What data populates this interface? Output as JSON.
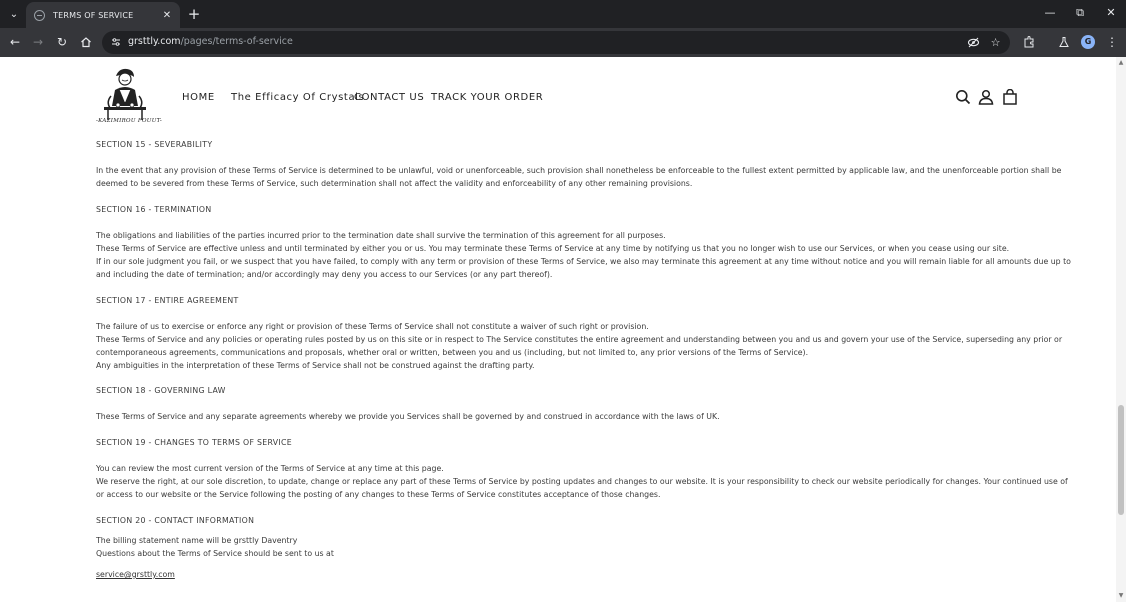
{
  "browser": {
    "tab_title": "TERMS OF SERVICE",
    "url_host": "grsttly.com",
    "url_path": "/pages/terms-of-service",
    "profile_initial": "G"
  },
  "site": {
    "logo_text": "-KAZIMIROU FOUUT-",
    "nav": [
      "HOME",
      "The Efficacy Of Crystals",
      "CONTACT US",
      "TRACK YOUR ORDER"
    ]
  },
  "content": {
    "s15_title": "SECTION 15 - SEVERABILITY",
    "s15_p1": "In the event that any provision of these Terms of Service is determined to be unlawful, void or unenforceable, such provision shall nonetheless be enforceable to the fullest extent permitted by applicable law, and the unenforceable portion shall be",
    "s15_p2": "deemed to be severed from these Terms of Service, such determination shall not affect the validity and enforceability of any other remaining provisions.",
    "s16_title": "SECTION 16 - TERMINATION",
    "s16_p1": "The obligations and liabilities of the parties incurred prior to the termination date shall survive the termination of this agreement for all purposes.",
    "s16_p2": "These Terms of Service are effective unless and until terminated by either you or us. You may terminate these Terms of Service at any time by notifying us that you no longer wish to use our Services, or when you cease using our site.",
    "s16_p3": "If in our sole judgment you fail, or we suspect that you have failed, to comply with any term or provision of these Terms of Service, we also may terminate this agreement at any time without notice and you will remain liable for all amounts due up to",
    "s16_p4": "and including the date of termination; and/or accordingly may deny you access to our Services (or any part thereof).",
    "s17_title": "SECTION 17 - ENTIRE AGREEMENT",
    "s17_p1": "The failure of us to exercise or enforce any right or provision of these Terms of Service shall not constitute a waiver of such right or provision.",
    "s17_p2": "These Terms of Service and any policies or operating rules posted by us on this site or in respect to The Service constitutes the entire agreement and understanding between you and us and govern your use of the Service, superseding any prior or",
    "s17_p3": "contemporaneous agreements, communications and proposals, whether oral or written, between you and us (including, but not limited to, any prior versions of the Terms of Service).",
    "s17_p4": "Any ambiguities in the interpretation of these Terms of Service shall not be construed against the drafting party.",
    "s18_title": "SECTION 18 - GOVERNING LAW",
    "s18_p1": "These Terms of Service and any separate agreements whereby we provide you Services shall be governed by and construed in accordance with the laws of UK.",
    "s19_title": "SECTION 19 - CHANGES TO TERMS OF SERVICE",
    "s19_p1": "You can review the most current version of the Terms of Service at any time at this page.",
    "s19_p2": "We reserve the right, at our sole discretion, to update, change or replace any part of these Terms of Service by posting updates and changes to our website. It is your responsibility to check our website periodically for changes. Your continued use of",
    "s19_p3": "or access to our website or the Service following the posting of any changes to these Terms of Service constitutes acceptance of those changes.",
    "s20_title": "SECTION 20 - CONTACT INFORMATION",
    "s20_p1": "The billing statement name will be grsttly Daventry",
    "s20_p2": "Questions about the Terms of Service should be sent to us at",
    "email": "service@grsttly.com"
  }
}
